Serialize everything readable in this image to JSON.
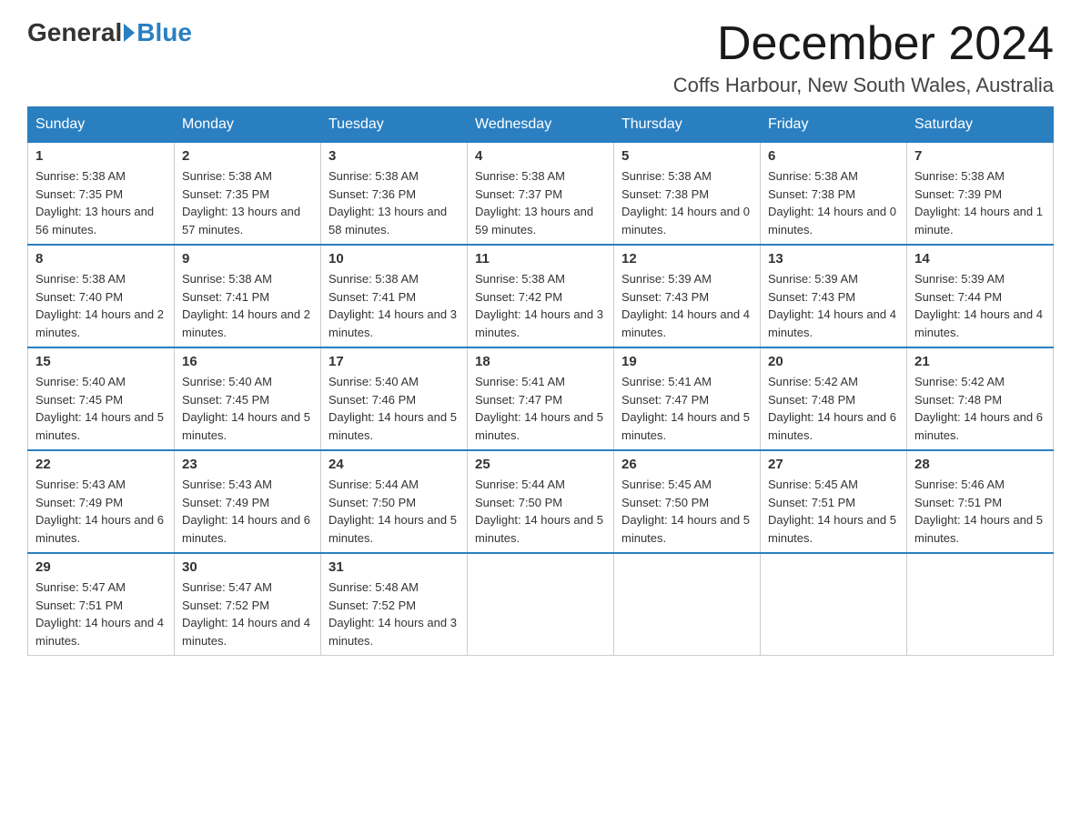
{
  "logo": {
    "general": "General",
    "blue": "Blue"
  },
  "title": "December 2024",
  "location": "Coffs Harbour, New South Wales, Australia",
  "days_of_week": [
    "Sunday",
    "Monday",
    "Tuesday",
    "Wednesday",
    "Thursday",
    "Friday",
    "Saturday"
  ],
  "weeks": [
    [
      {
        "day": "1",
        "sunrise": "5:38 AM",
        "sunset": "7:35 PM",
        "daylight": "13 hours and 56 minutes."
      },
      {
        "day": "2",
        "sunrise": "5:38 AM",
        "sunset": "7:35 PM",
        "daylight": "13 hours and 57 minutes."
      },
      {
        "day": "3",
        "sunrise": "5:38 AM",
        "sunset": "7:36 PM",
        "daylight": "13 hours and 58 minutes."
      },
      {
        "day": "4",
        "sunrise": "5:38 AM",
        "sunset": "7:37 PM",
        "daylight": "13 hours and 59 minutes."
      },
      {
        "day": "5",
        "sunrise": "5:38 AM",
        "sunset": "7:38 PM",
        "daylight": "14 hours and 0 minutes."
      },
      {
        "day": "6",
        "sunrise": "5:38 AM",
        "sunset": "7:38 PM",
        "daylight": "14 hours and 0 minutes."
      },
      {
        "day": "7",
        "sunrise": "5:38 AM",
        "sunset": "7:39 PM",
        "daylight": "14 hours and 1 minute."
      }
    ],
    [
      {
        "day": "8",
        "sunrise": "5:38 AM",
        "sunset": "7:40 PM",
        "daylight": "14 hours and 2 minutes."
      },
      {
        "day": "9",
        "sunrise": "5:38 AM",
        "sunset": "7:41 PM",
        "daylight": "14 hours and 2 minutes."
      },
      {
        "day": "10",
        "sunrise": "5:38 AM",
        "sunset": "7:41 PM",
        "daylight": "14 hours and 3 minutes."
      },
      {
        "day": "11",
        "sunrise": "5:38 AM",
        "sunset": "7:42 PM",
        "daylight": "14 hours and 3 minutes."
      },
      {
        "day": "12",
        "sunrise": "5:39 AM",
        "sunset": "7:43 PM",
        "daylight": "14 hours and 4 minutes."
      },
      {
        "day": "13",
        "sunrise": "5:39 AM",
        "sunset": "7:43 PM",
        "daylight": "14 hours and 4 minutes."
      },
      {
        "day": "14",
        "sunrise": "5:39 AM",
        "sunset": "7:44 PM",
        "daylight": "14 hours and 4 minutes."
      }
    ],
    [
      {
        "day": "15",
        "sunrise": "5:40 AM",
        "sunset": "7:45 PM",
        "daylight": "14 hours and 5 minutes."
      },
      {
        "day": "16",
        "sunrise": "5:40 AM",
        "sunset": "7:45 PM",
        "daylight": "14 hours and 5 minutes."
      },
      {
        "day": "17",
        "sunrise": "5:40 AM",
        "sunset": "7:46 PM",
        "daylight": "14 hours and 5 minutes."
      },
      {
        "day": "18",
        "sunrise": "5:41 AM",
        "sunset": "7:47 PM",
        "daylight": "14 hours and 5 minutes."
      },
      {
        "day": "19",
        "sunrise": "5:41 AM",
        "sunset": "7:47 PM",
        "daylight": "14 hours and 5 minutes."
      },
      {
        "day": "20",
        "sunrise": "5:42 AM",
        "sunset": "7:48 PM",
        "daylight": "14 hours and 6 minutes."
      },
      {
        "day": "21",
        "sunrise": "5:42 AM",
        "sunset": "7:48 PM",
        "daylight": "14 hours and 6 minutes."
      }
    ],
    [
      {
        "day": "22",
        "sunrise": "5:43 AM",
        "sunset": "7:49 PM",
        "daylight": "14 hours and 6 minutes."
      },
      {
        "day": "23",
        "sunrise": "5:43 AM",
        "sunset": "7:49 PM",
        "daylight": "14 hours and 6 minutes."
      },
      {
        "day": "24",
        "sunrise": "5:44 AM",
        "sunset": "7:50 PM",
        "daylight": "14 hours and 5 minutes."
      },
      {
        "day": "25",
        "sunrise": "5:44 AM",
        "sunset": "7:50 PM",
        "daylight": "14 hours and 5 minutes."
      },
      {
        "day": "26",
        "sunrise": "5:45 AM",
        "sunset": "7:50 PM",
        "daylight": "14 hours and 5 minutes."
      },
      {
        "day": "27",
        "sunrise": "5:45 AM",
        "sunset": "7:51 PM",
        "daylight": "14 hours and 5 minutes."
      },
      {
        "day": "28",
        "sunrise": "5:46 AM",
        "sunset": "7:51 PM",
        "daylight": "14 hours and 5 minutes."
      }
    ],
    [
      {
        "day": "29",
        "sunrise": "5:47 AM",
        "sunset": "7:51 PM",
        "daylight": "14 hours and 4 minutes."
      },
      {
        "day": "30",
        "sunrise": "5:47 AM",
        "sunset": "7:52 PM",
        "daylight": "14 hours and 4 minutes."
      },
      {
        "day": "31",
        "sunrise": "5:48 AM",
        "sunset": "7:52 PM",
        "daylight": "14 hours and 3 minutes."
      },
      null,
      null,
      null,
      null
    ]
  ]
}
